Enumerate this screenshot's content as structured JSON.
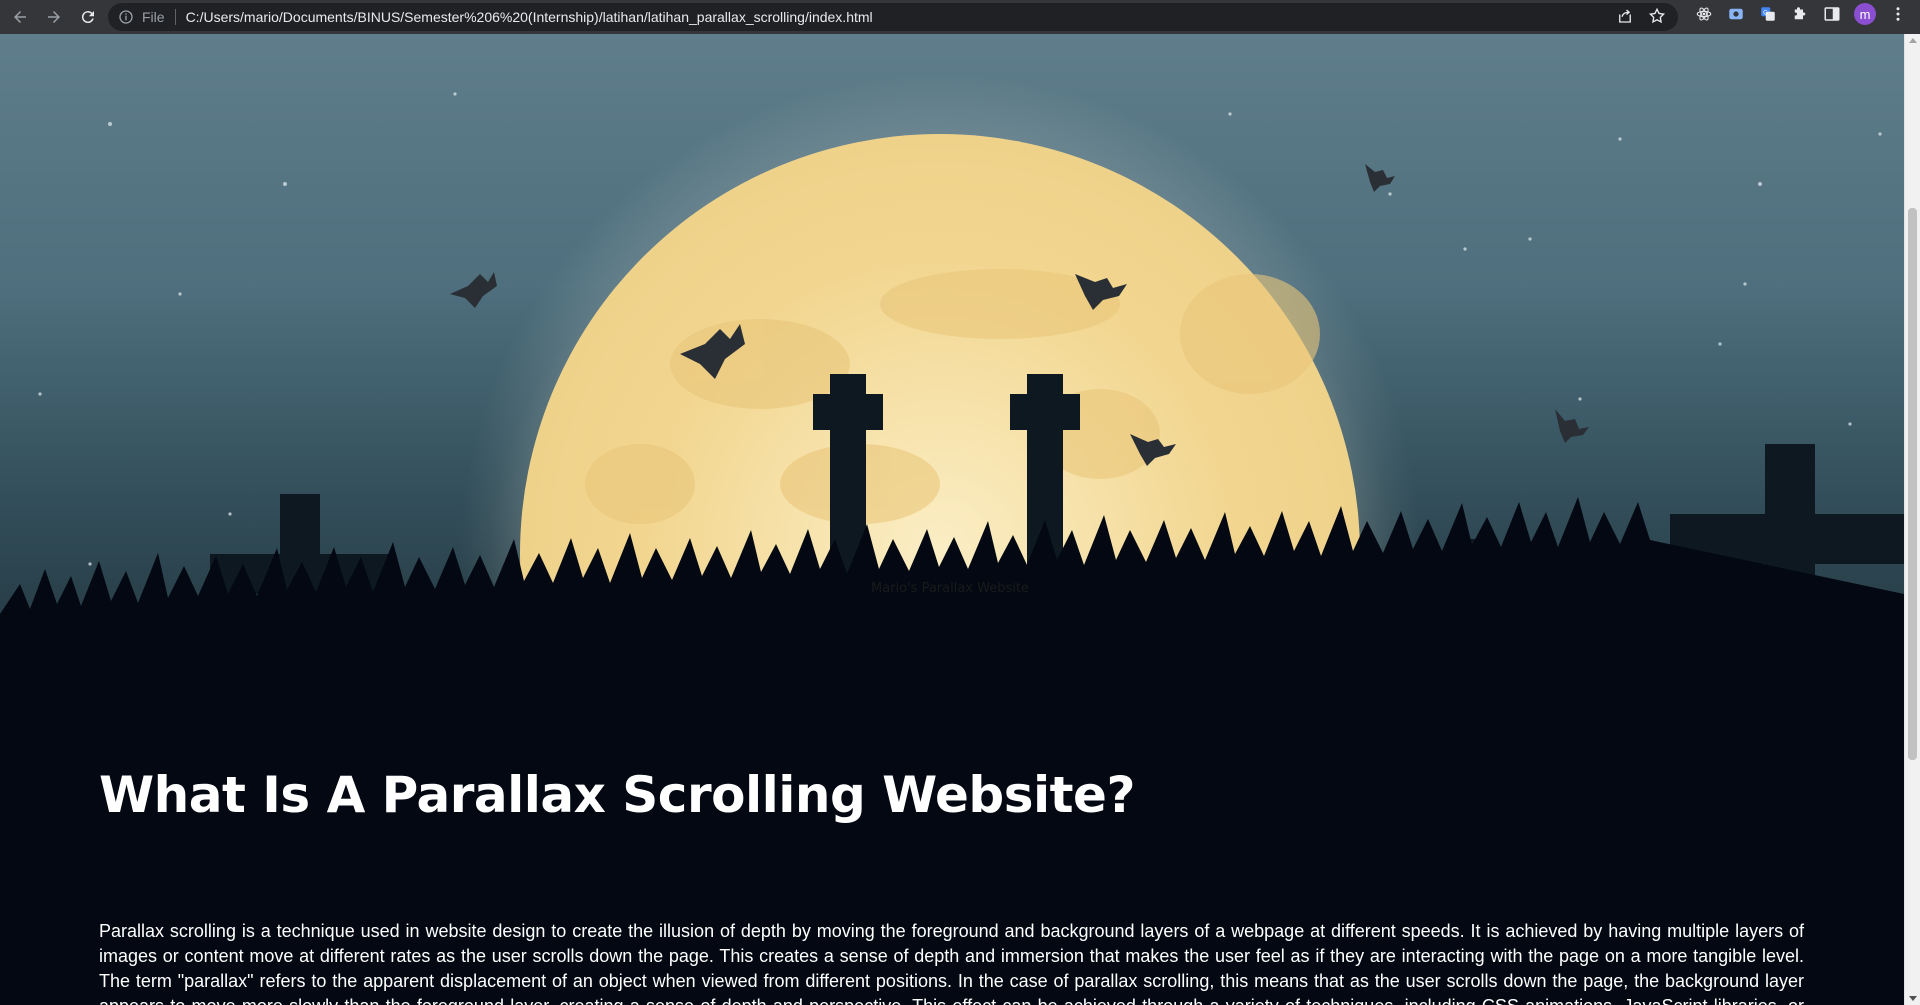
{
  "browser": {
    "scheme_label": "File",
    "url": "C:/Users/mario/Documents/BINUS/Semester%206%20(Internship)/latihan/latihan_parallax_scrolling/index.html",
    "profile_initial": "m",
    "icons": [
      "back-icon",
      "forward-icon",
      "reload-icon",
      "site-info-icon",
      "share-icon",
      "bookmark-star-icon",
      "extension-react-icon",
      "extension-screen-icon",
      "extension-translate-icon",
      "extensions-puzzle-icon",
      "side-panel-icon",
      "menu-dots-icon"
    ]
  },
  "hero": {
    "caption": "Mario's Parallax Website"
  },
  "content": {
    "heading": "What Is A Parallax Scrolling Website?",
    "paragraph": "Parallax scrolling is a technique used in website design to create the illusion of depth by moving the foreground and background layers of a webpage at different speeds. It is achieved by having multiple layers of images or content move at different rates as the user scrolls down the page. This creates a sense of depth and immersion that makes the user feel as if they are interacting with the page on a more tangible level. The term \"parallax\" refers to the apparent displacement of an object when viewed from different positions. In the case of parallax scrolling, this means that as the user scrolls down the page, the background layer appears to move more slowly than the foreground layer, creating a sense of depth and perspective. This effect can be achieved through a variety of techniques, including CSS animations, JavaScript libraries, or dedicated parallax scrolling plugins. Parallax scrolling is a popular design trend in modern website design, and it is often used to create engaging and interactive user experiences. One of the key benefits of"
  },
  "colors": {
    "chrome_bg": "#35363a",
    "omnibox_bg": "#202124",
    "page_bg": "#030812",
    "moon": "#f6dfa0",
    "avatar": "#8a4fd0"
  }
}
